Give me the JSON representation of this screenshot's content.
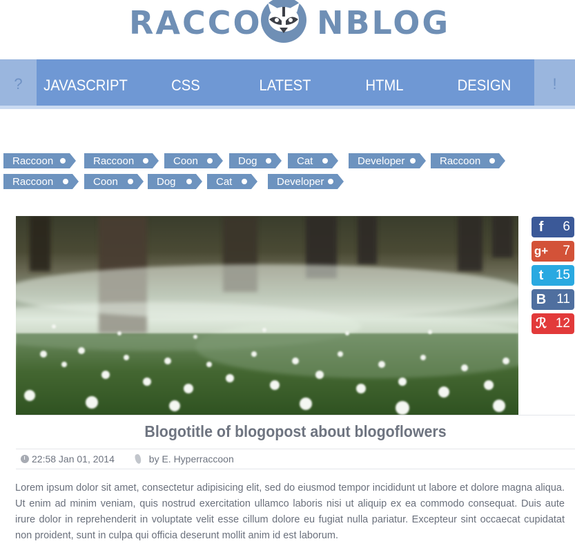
{
  "logo": {
    "left": "RACCO",
    "right": "NBLOG"
  },
  "nav": {
    "left_icon": "?",
    "right_icon": "!",
    "items": [
      "JAVASCRIPT",
      "CSS",
      "LATEST",
      "HTML",
      "DESIGN"
    ]
  },
  "tags": {
    "row1": [
      "Raccoon",
      "Raccoon",
      "Coon",
      "Dog",
      "Cat",
      "Developer",
      "Raccoon"
    ],
    "row2": [
      "Raccoon",
      "Coon",
      "Dog",
      "Cat",
      "Developer"
    ]
  },
  "share": [
    {
      "network": "facebook",
      "icon": "facebook-icon",
      "label": "f",
      "count": "6",
      "color": "#3b5998"
    },
    {
      "network": "google-plus",
      "icon": "google-plus-icon",
      "label": "g+",
      "count": "7",
      "color": "#d35238"
    },
    {
      "network": "twitter",
      "icon": "twitter-icon",
      "label": "t",
      "count": "15",
      "color": "#29a9e1"
    },
    {
      "network": "vk",
      "icon": "vk-icon",
      "label": "B",
      "count": "11",
      "color": "#4f6f9f"
    },
    {
      "network": "other",
      "icon": "runner-icon",
      "label": "ℛ",
      "count": "12",
      "color": "#e23a3a"
    }
  ],
  "post": {
    "title": "Blogotitle of blogopost about blogoflowers",
    "date": "22:58 Jan 01, 2014",
    "author": "by E. Hyperraccoon",
    "body": "Lorem ipsum dolor sit amet, consectetur adipisicing elit, sed do eiusmod tempor incididunt ut labore et dolore magna aliqua. Ut enim ad minim veniam, quis nostrud exercitation ullamco laboris nisi ut aliquip ex ea commodo consequat. Duis aute irure dolor in reprehenderit in voluptate velit esse cillum dolore eu fugiat nulla pariatur. Excepteur sint occaecat cupidatat non proident, sunt in culpa qui officia deserunt mollit anim id est laborum."
  }
}
